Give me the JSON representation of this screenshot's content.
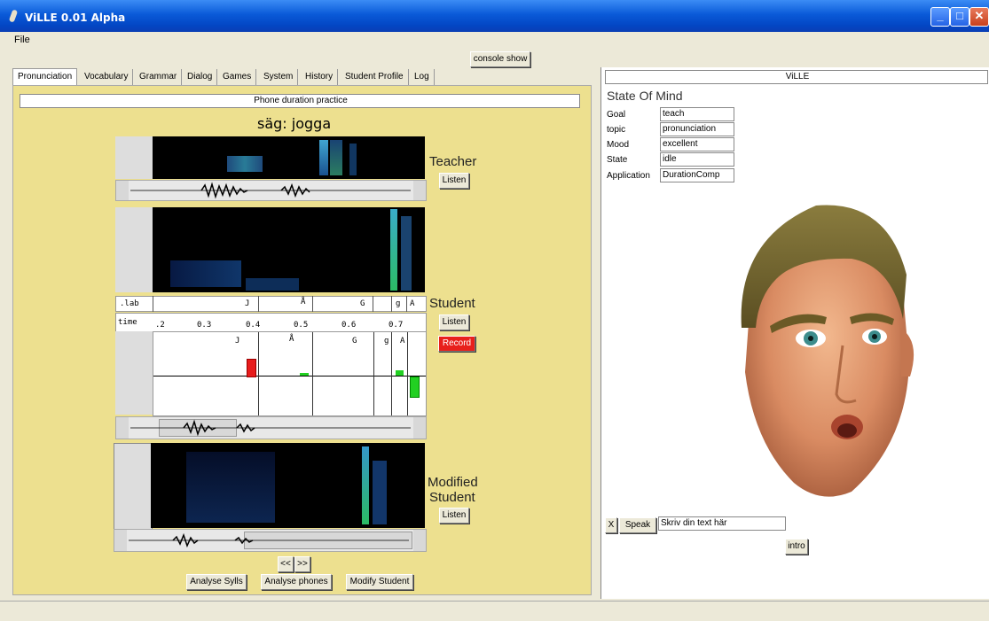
{
  "window": {
    "title": "ViLLE 0.01 Alpha",
    "min": "_",
    "max": "□",
    "close": "✕"
  },
  "menu": {
    "file": "File"
  },
  "console_button": "console show",
  "tabs": [
    "Pronunciation",
    "Vocabulary",
    "Grammar",
    "Dialog",
    "Games",
    "System",
    "History",
    "Student Profile",
    "Log"
  ],
  "practice": {
    "title": "Phone duration practice",
    "word": "säg: jogga",
    "teacher_label": "Teacher",
    "student_label": "Student",
    "modified_label_1": "Modified",
    "modified_label_2": "Student",
    "listen": "Listen",
    "record": "Record",
    "lab_label": ".lab",
    "time_label": "time",
    "lab_marks": [
      "J",
      "Å",
      "G",
      "g",
      "A"
    ],
    "time_ticks": [
      ".2",
      "0.3",
      "0.4",
      "0.5",
      "0.6",
      "0.7"
    ],
    "dur_marks": [
      "J",
      "Å",
      "G",
      "g",
      "A"
    ],
    "prev": "<<",
    "next": ">>",
    "analyse_sylls": "Analyse Sylls",
    "analyse_phones": "Analyse phones",
    "modify_student": "Modify Student"
  },
  "ville": {
    "title": "ViLLE",
    "state_title": "State Of Mind",
    "rows": [
      {
        "label": "Goal",
        "value": "teach"
      },
      {
        "label": "topic",
        "value": "pronunciation"
      },
      {
        "label": "Mood",
        "value": "excellent"
      },
      {
        "label": "State",
        "value": "idle"
      },
      {
        "label": "Application",
        "value": "DurationComp"
      }
    ],
    "x_button": "X",
    "speak_button": "Speak",
    "speak_input": "Skriv din text här",
    "intro_button": "intro"
  },
  "colors": {
    "panel": "#ede08f",
    "record": "#e8201c",
    "bar_long": "#e81c1c",
    "bar_short": "#22d022"
  }
}
